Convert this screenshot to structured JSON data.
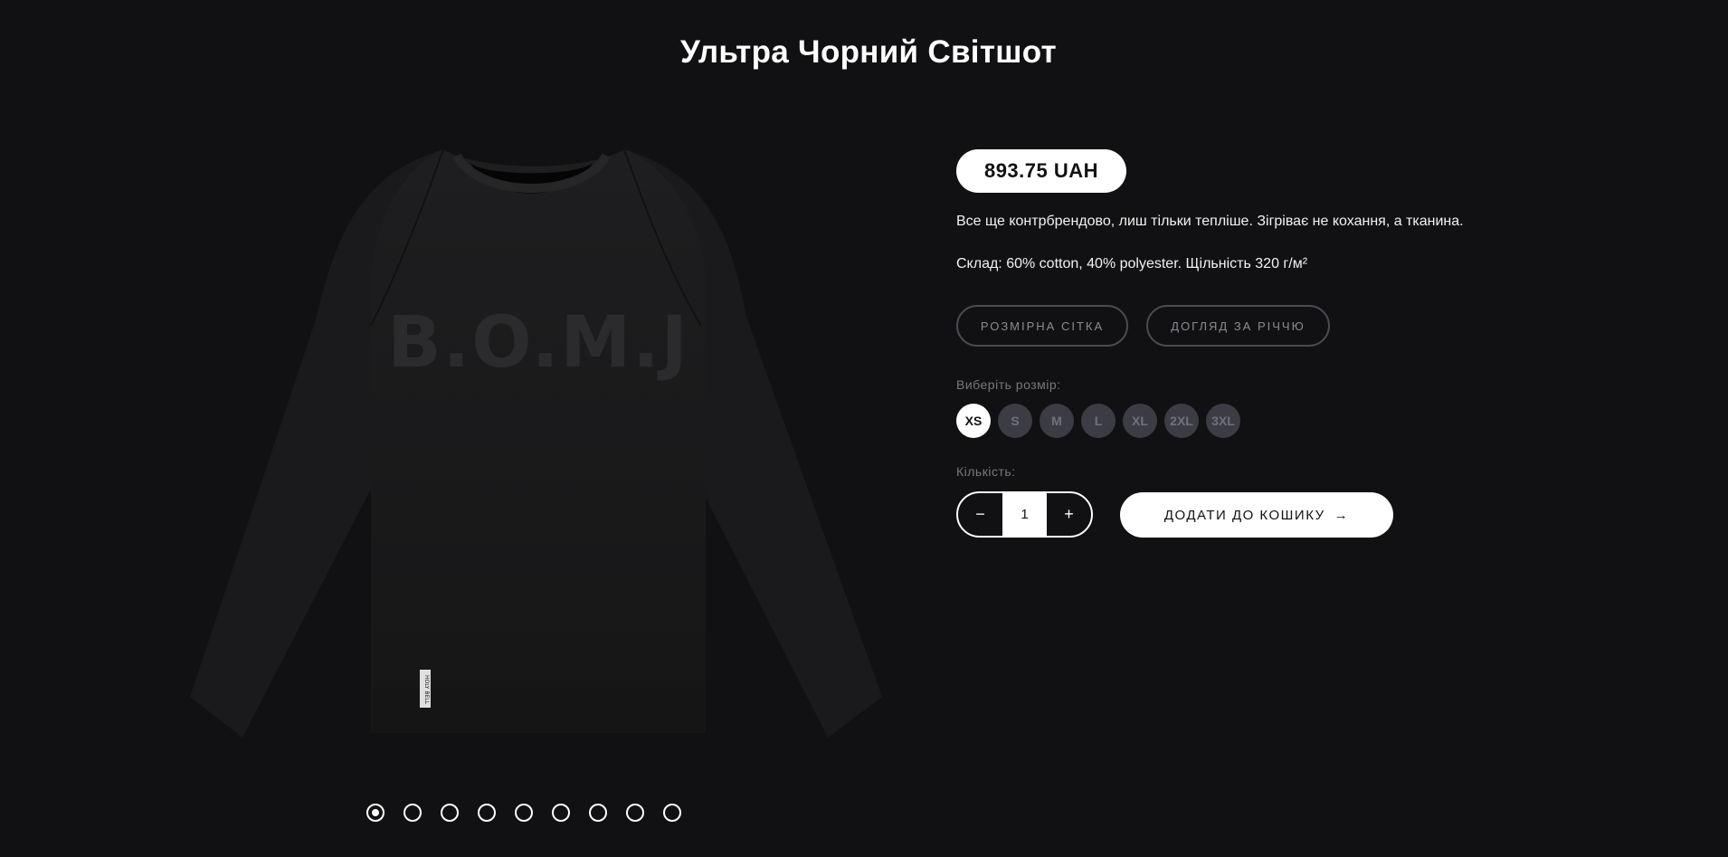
{
  "product": {
    "title": "Ультра Чорний Світшот",
    "price": "893.75 UAH",
    "description": "Все ще контрбрендово, лиш тільки тепліше. Зігріває не кохання, а тканина.",
    "composition": "Склад: 60% cotton, 40% polyester. Щільність 320 г/м²",
    "print_text": "B.O.M.J",
    "tag_text": "HOLY BELL"
  },
  "buttons": {
    "size_chart": "РОЗМІРНА СІТКА",
    "care": "ДОГЛЯД ЗА РІЧЧЮ",
    "add_to_cart": "ДОДАТИ ДО КОШИКУ",
    "add_to_cart_icon": "→"
  },
  "size_selector": {
    "label": "Виберіть розмір:",
    "options": [
      "XS",
      "S",
      "M",
      "L",
      "XL",
      "2XL",
      "3XL"
    ],
    "selected": "XS"
  },
  "quantity": {
    "label": "Кількість:",
    "value": "1",
    "minus": "−",
    "plus": "+"
  },
  "gallery": {
    "image_count": 9,
    "active_index": 0
  },
  "colors": {
    "background": "#111113",
    "accent": "#ffffff",
    "disabled_size": "#3c3c45"
  }
}
